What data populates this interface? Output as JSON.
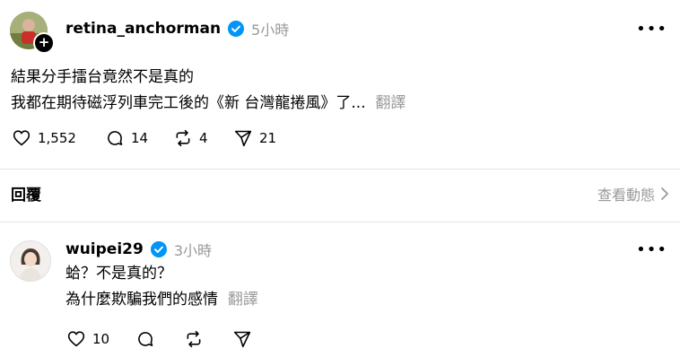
{
  "post": {
    "username": "retina_anchorman",
    "time": "5小時",
    "lines": [
      "結果分手擂台竟然不是真的",
      "我都在期待磁浮列車完工後的《新 台灣龍捲風》了..."
    ],
    "translate": "翻譯",
    "actions": {
      "likes": "1,552",
      "comments": "14",
      "reposts": "4",
      "shares": "21"
    }
  },
  "replies_section": {
    "title": "回覆",
    "view_activity": "查看動態"
  },
  "reply": {
    "username": "wuipei29",
    "time": "3小時",
    "lines": [
      "蛤？不是真的？",
      "為什麼欺騙我們的感情"
    ],
    "translate": "翻譯",
    "actions": {
      "likes": "10"
    }
  },
  "colors": {
    "verified": "#0095f6",
    "muted": "#999999"
  }
}
